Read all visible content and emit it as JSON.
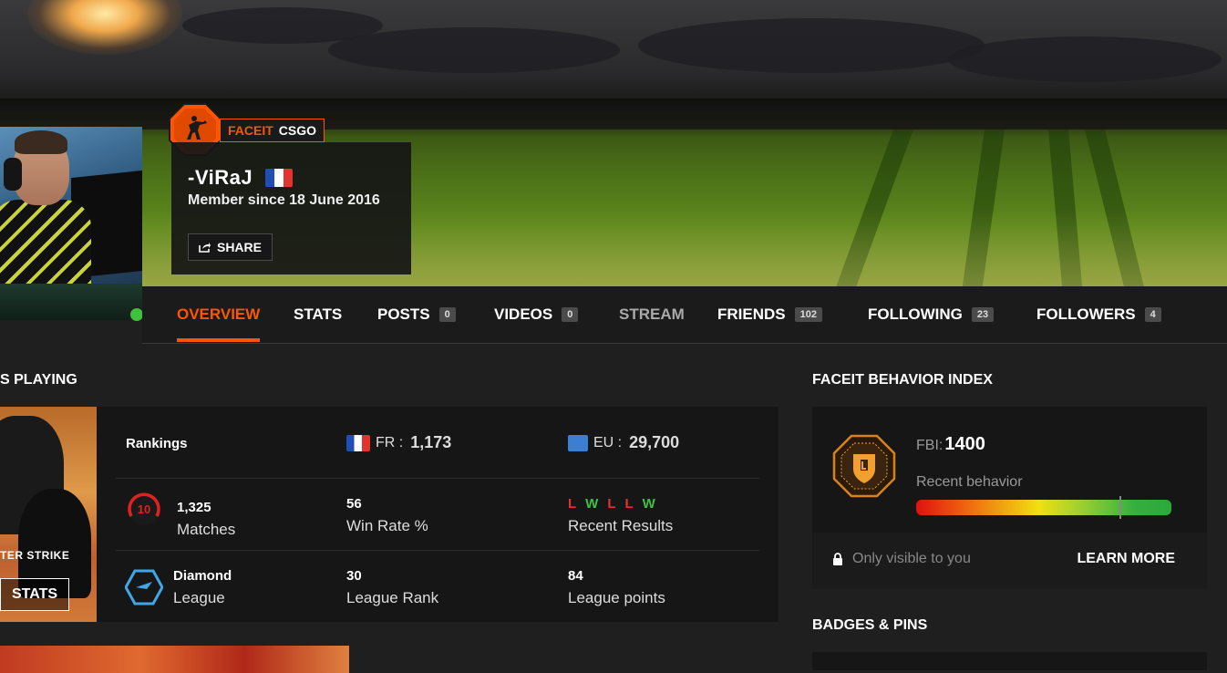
{
  "profile": {
    "brand": "FACEIT",
    "game": "CSGO",
    "nickname": "-ViRaJ",
    "member_since": "Member since 18 June 2016",
    "share_label": "SHARE",
    "country_flag": "france-flag-icon",
    "online": true
  },
  "nav": {
    "tabs": [
      {
        "label": "OVERVIEW",
        "active": true
      },
      {
        "label": "STATS"
      },
      {
        "label": "POSTS",
        "count": "0"
      },
      {
        "label": "VIDEOS",
        "count": "0"
      },
      {
        "label": "STREAM"
      },
      {
        "label": "FRIENDS",
        "count": "102"
      },
      {
        "label": "FOLLOWING",
        "count": "23"
      },
      {
        "label": "FOLLOWERS",
        "count": "4"
      }
    ]
  },
  "playing": {
    "title": "S PLAYING",
    "game_logo": "TER STRIKE",
    "stats_button": "STATS",
    "rankings_label": "Rankings",
    "rank_country": {
      "code": "FR",
      "value": "1,173"
    },
    "rank_region": {
      "code": "EU",
      "value": "29,700"
    },
    "matches": {
      "value": "1,325",
      "label": "Matches"
    },
    "level": "10",
    "win_rate": {
      "value": "56",
      "label": "Win Rate %"
    },
    "recent_results": {
      "value": [
        "L",
        "W",
        "L",
        "L",
        "W"
      ],
      "label": "Recent Results"
    },
    "league": {
      "value": "Diamond",
      "label": "League"
    },
    "league_rank": {
      "value": "30",
      "label": "League Rank"
    },
    "league_points": {
      "value": "84",
      "label": "League points"
    }
  },
  "fbi": {
    "title": "FACEIT BEHAVIOR INDEX",
    "label": "FBI:",
    "value": "1400",
    "recent_behavior": "Recent behavior",
    "behavior_level": 0.8,
    "privacy": "Only visible to you",
    "learn_more": "LEARN MORE"
  },
  "badges": {
    "title": "BADGES & PINS"
  },
  "colors": {
    "accent": "#ff5500",
    "win": "#3ec13e",
    "loss": "#e0332f",
    "background": "#1f1f1f",
    "card": "#161616"
  }
}
